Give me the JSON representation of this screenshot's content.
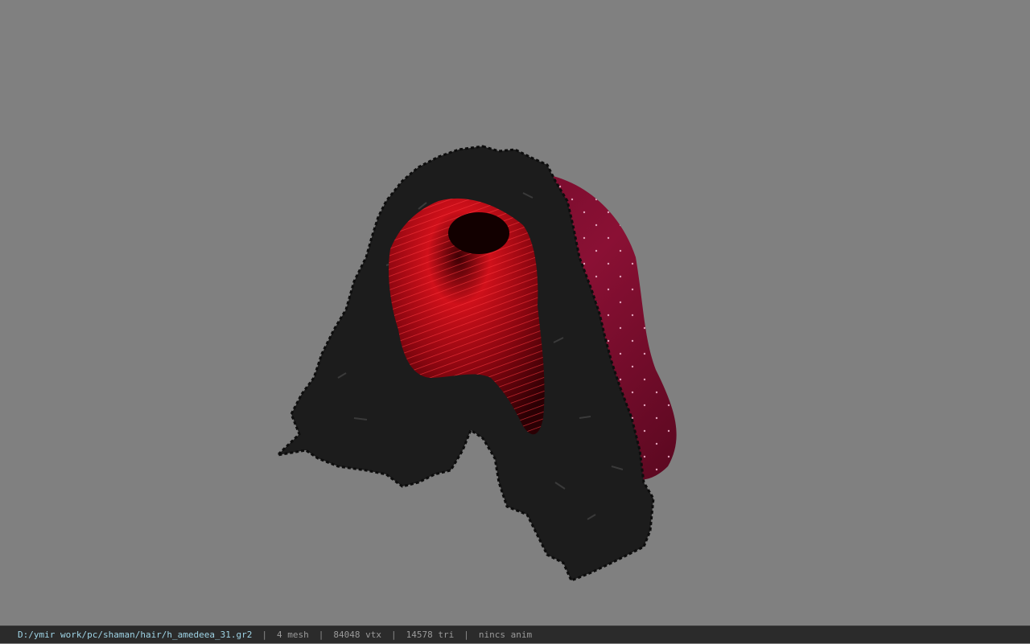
{
  "viewer": {
    "background_color": "#808080",
    "model": {
      "description_icon": "hair-model-3d",
      "colors": {
        "hair_black": "#1a1a1a",
        "hair_red": "#c0101c",
        "scalp_cap": "#7a0d2e"
      }
    }
  },
  "statusbar": {
    "file_path": "D:/ymir work/pc/shaman/hair/h_amedeea_31.gr2",
    "separator": "|",
    "mesh_count": "4 mesh",
    "vertex_count": "84048 vtx",
    "triangle_count": "14578 tri",
    "animation": "nincs anim"
  }
}
